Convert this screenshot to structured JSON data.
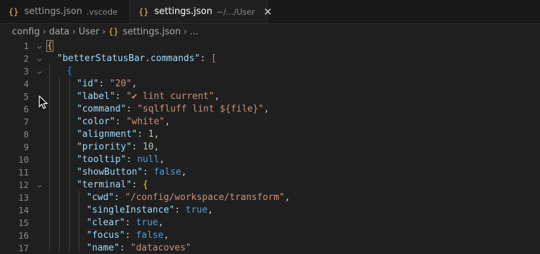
{
  "tabs": [
    {
      "icon": "{}",
      "name": "settings.json",
      "description": ".vscode"
    },
    {
      "icon": "{}",
      "name": "settings.json",
      "description": "~/.../User",
      "close": "✕"
    }
  ],
  "breadcrumb": {
    "items": [
      "config",
      "data",
      "User"
    ],
    "file_icon": "{}",
    "file": "settings.json",
    "ellipsis": "..."
  },
  "editor": {
    "line_numbers": [
      "1",
      "2",
      "3",
      "4",
      "5",
      "6",
      "7",
      "8",
      "9",
      "10",
      "11",
      "12",
      "13",
      "14",
      "15",
      "16",
      "17"
    ],
    "fold_glyph": "⌵",
    "lines": {
      "l1_open": "{",
      "l2_key": "\"betterStatusBar.commands\"",
      "l2_colon": ": ",
      "l2_open": "[",
      "l3_open": "{",
      "l4_key": "\"id\"",
      "l4_val": "\"20\"",
      "l5_key": "\"label\"",
      "l5_val": "\"✔ lint current\"",
      "l6_key": "\"command\"",
      "l6_val": "\"sqlfluff lint ${file}\"",
      "l7_key": "\"color\"",
      "l7_val": "\"white\"",
      "l8_key": "\"alignment\"",
      "l8_val": "1",
      "l9_key": "\"priority\"",
      "l9_val": "10",
      "l10_key": "\"tooltip\"",
      "l10_val": "null",
      "l11_key": "\"showButton\"",
      "l11_val": "false",
      "l12_key": "\"terminal\"",
      "l12_open": "{",
      "l13_key": "\"cwd\"",
      "l13_val": "\"/config/workspace/transform\"",
      "l14_key": "\"singleInstance\"",
      "l14_val": "true",
      "l15_key": "\"clear\"",
      "l15_val": "true",
      "l16_key": "\"focus\"",
      "l16_val": "false",
      "l17_key": "\"name\"",
      "l17_val": "\"datacoves\""
    }
  },
  "colors": {
    "background": "#1f1f1f",
    "key": "#9cdcfe",
    "string": "#ce9178",
    "number": "#b5cea8",
    "keyword": "#569cd6",
    "json_icon": "#e8c255"
  }
}
